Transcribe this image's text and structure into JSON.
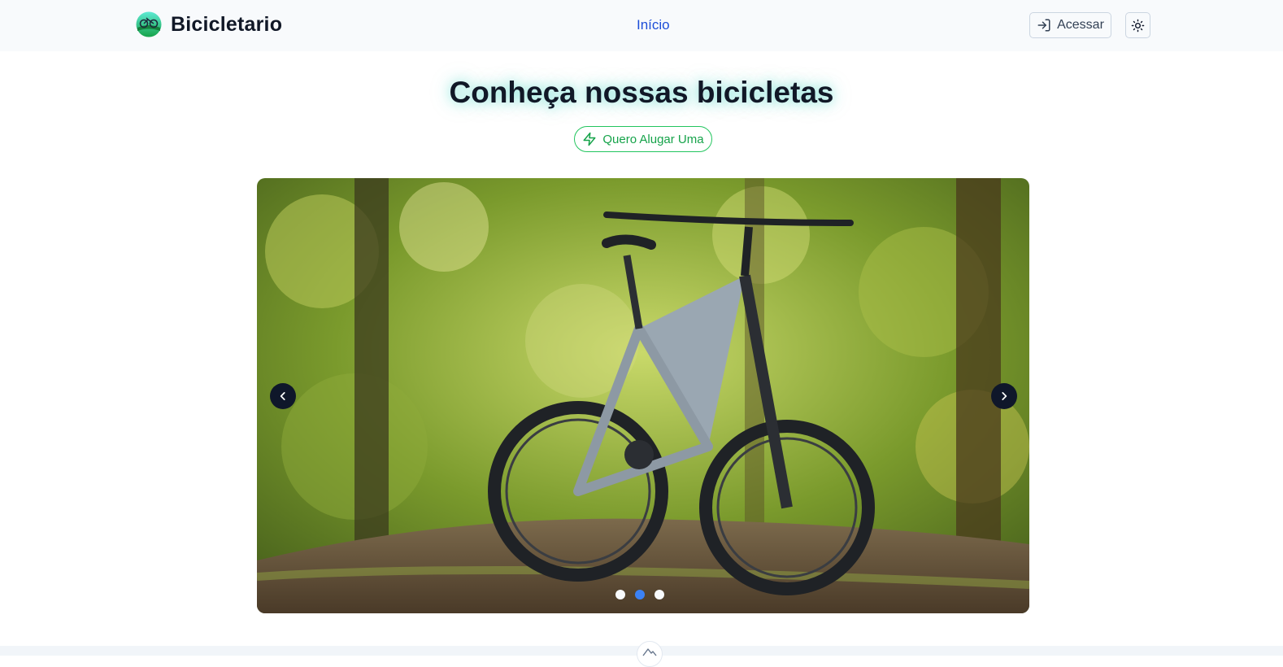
{
  "header": {
    "brand_name": "Bicicletario",
    "logo_icon": "bike-globe-logo-icon",
    "nav": {
      "home_label": "Início"
    },
    "login_label": "Acessar",
    "login_icon": "sign-in-icon",
    "theme_icon": "sun-icon"
  },
  "hero": {
    "title": "Conheça nossas bicicletas",
    "cta_label": "Quero Alugar Uma",
    "cta_icon": "lightning-icon"
  },
  "carousel": {
    "slide_count": 3,
    "active_index": 1,
    "image_subject": "full-suspension mountain bike in forest",
    "prev_icon": "chevron-left-icon",
    "next_icon": "chevron-right-icon"
  },
  "colors": {
    "accent": "#1d4ed8",
    "cta": "#16a34a",
    "dot_active": "#3b82f6",
    "arrow_bg": "#0f172a"
  }
}
